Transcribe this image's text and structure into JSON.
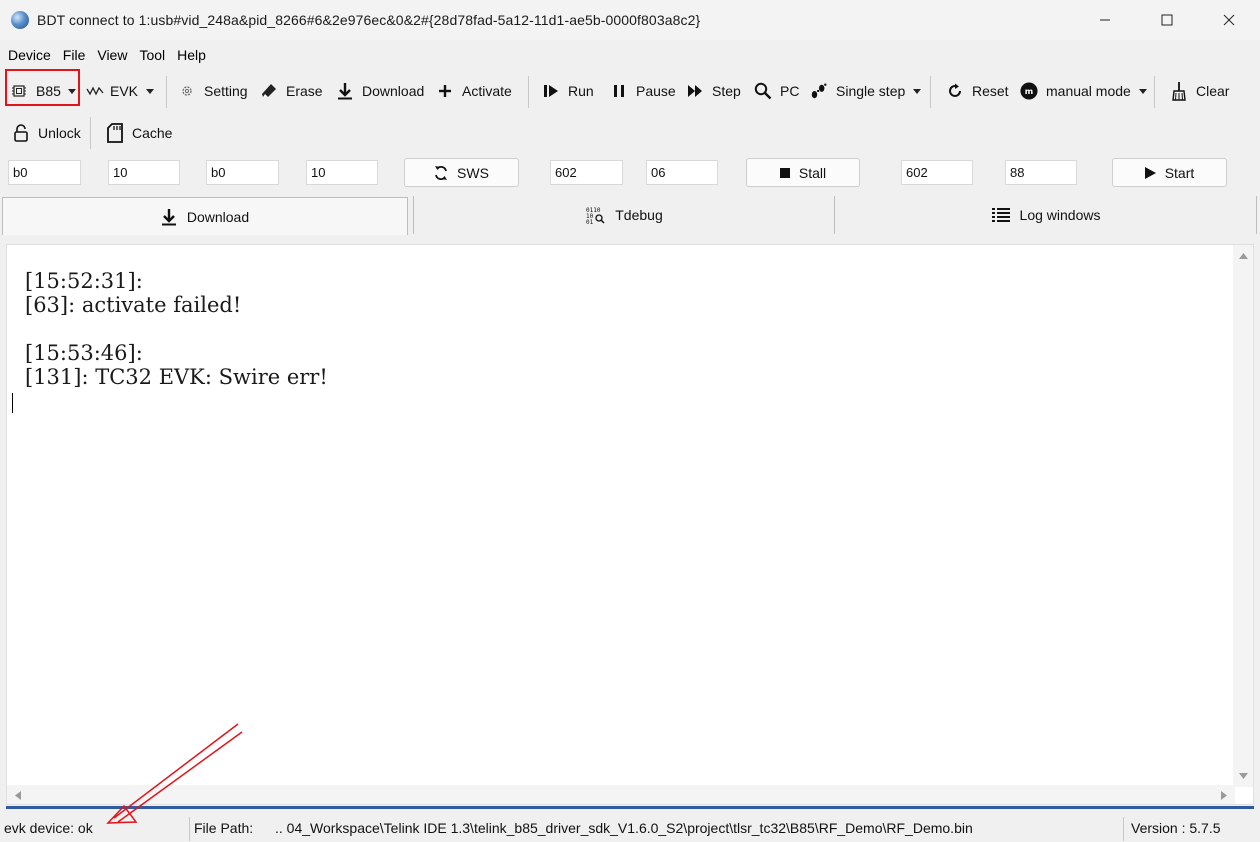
{
  "window": {
    "title": "BDT connect to 1:usb#vid_248a&pid_8266#6&2e976ec&0&2#{28d78fad-5a12-11d1-ae5b-0000f803a8c2}"
  },
  "menu": [
    "Device",
    "File",
    "View",
    "Tool",
    "Help"
  ],
  "toolbar": {
    "chip": "B85",
    "evk": "EVK",
    "setting": "Setting",
    "erase": "Erase",
    "download": "Download",
    "activate": "Activate",
    "run": "Run",
    "pause": "Pause",
    "step": "Step",
    "pc": "PC",
    "single_step": "Single step",
    "reset": "Reset",
    "mode": "manual mode",
    "clear": "Clear"
  },
  "toolbar2": {
    "unlock": "Unlock",
    "cache": "Cache"
  },
  "fields": {
    "f1": "b0",
    "f2": "10",
    "f3": "b0",
    "f4": "10",
    "sws": "SWS",
    "f5": "602",
    "f6": "06",
    "stall": "Stall",
    "f7": "602",
    "f8": "88",
    "start": "Start"
  },
  "tabs": {
    "download": "Download",
    "tdebug": "Tdebug",
    "log": "Log windows"
  },
  "log": {
    "line1": "[15:52:31]:",
    "line2": "[63]: activate failed!",
    "line3": "[15:53:46]:",
    "line4": "[131]: TC32 EVK: Swire err!"
  },
  "status": {
    "device": "evk device: ok",
    "file_path_label": "File Path:",
    "file_path": "..  04_Workspace\\Telink IDE 1.3\\telink_b85_driver_sdk_V1.6.0_S2\\project\\tlsr_tc32\\B85\\RF_Demo\\RF_Demo.bin",
    "version": "Version : 5.7.5"
  },
  "colors": {
    "highlight_box": "#e0141a",
    "annotation_arrow": "#e0141a",
    "status_line": "#2f5b9e"
  }
}
